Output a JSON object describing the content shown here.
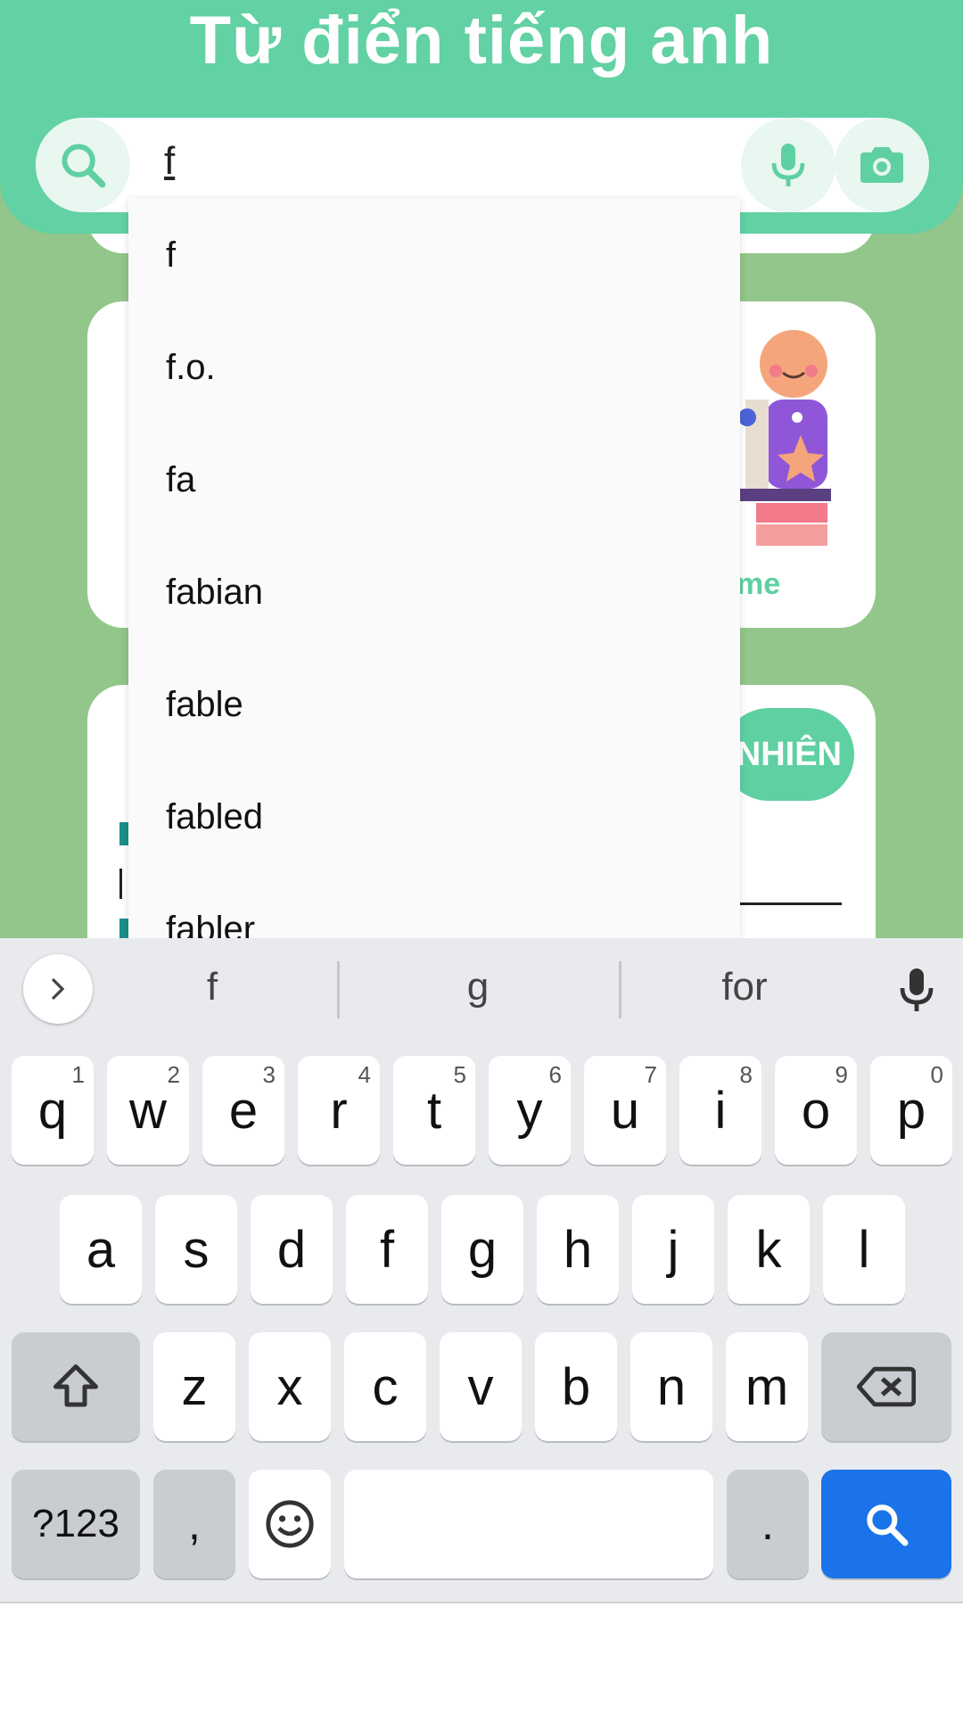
{
  "app": {
    "title": "Từ điển tiếng anh"
  },
  "search": {
    "value": "f"
  },
  "background": {
    "home_fragment": "me",
    "random_fragment": "NHIÊN"
  },
  "suggestions_dropdown": [
    "f",
    "f.o.",
    "fa",
    "fabian",
    "fable",
    "fabled",
    "fabler"
  ],
  "keyboard": {
    "word_suggestions": [
      "f",
      "g",
      "for"
    ],
    "row1": [
      {
        "key": "q",
        "hint": "1"
      },
      {
        "key": "w",
        "hint": "2"
      },
      {
        "key": "e",
        "hint": "3"
      },
      {
        "key": "r",
        "hint": "4"
      },
      {
        "key": "t",
        "hint": "5"
      },
      {
        "key": "y",
        "hint": "6"
      },
      {
        "key": "u",
        "hint": "7"
      },
      {
        "key": "i",
        "hint": "8"
      },
      {
        "key": "o",
        "hint": "9"
      },
      {
        "key": "p",
        "hint": "0"
      }
    ],
    "row2": [
      "a",
      "s",
      "d",
      "f",
      "g",
      "h",
      "j",
      "k",
      "l"
    ],
    "row3": [
      "z",
      "x",
      "c",
      "v",
      "b",
      "n",
      "m"
    ],
    "symbols_label": "?123",
    "comma": ",",
    "period": "."
  },
  "colors": {
    "header": "#62d1a3",
    "background": "#92c68a",
    "accent_blue": "#1a73e8"
  },
  "icons": [
    "search-icon",
    "mic-icon",
    "camera-icon",
    "chevron-right-icon",
    "shift-icon",
    "backspace-icon",
    "emoji-icon",
    "keyboard-search-icon"
  ]
}
